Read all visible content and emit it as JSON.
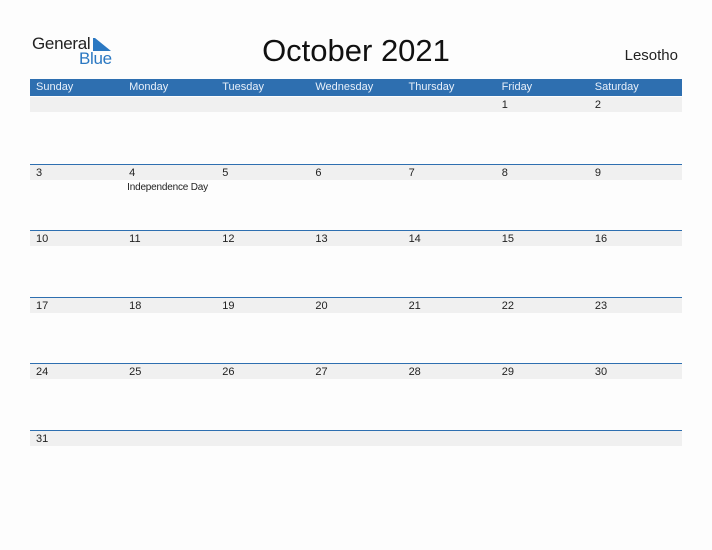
{
  "logo": {
    "general": "General",
    "blue": "Blue"
  },
  "title": "October 2021",
  "country": "Lesotho",
  "colors": {
    "accent": "#2e6fb0",
    "strip": "#f0f0f0",
    "logo_blue": "#2b78c2"
  },
  "weekdays": [
    "Sunday",
    "Monday",
    "Tuesday",
    "Wednesday",
    "Thursday",
    "Friday",
    "Saturday"
  ],
  "weeks": [
    [
      {
        "day": ""
      },
      {
        "day": ""
      },
      {
        "day": ""
      },
      {
        "day": ""
      },
      {
        "day": ""
      },
      {
        "day": "1"
      },
      {
        "day": "2"
      }
    ],
    [
      {
        "day": "3"
      },
      {
        "day": "4",
        "event": "Independence Day"
      },
      {
        "day": "5"
      },
      {
        "day": "6"
      },
      {
        "day": "7"
      },
      {
        "day": "8"
      },
      {
        "day": "9"
      }
    ],
    [
      {
        "day": "10"
      },
      {
        "day": "11"
      },
      {
        "day": "12"
      },
      {
        "day": "13"
      },
      {
        "day": "14"
      },
      {
        "day": "15"
      },
      {
        "day": "16"
      }
    ],
    [
      {
        "day": "17"
      },
      {
        "day": "18"
      },
      {
        "day": "19"
      },
      {
        "day": "20"
      },
      {
        "day": "21"
      },
      {
        "day": "22"
      },
      {
        "day": "23"
      }
    ],
    [
      {
        "day": "24"
      },
      {
        "day": "25"
      },
      {
        "day": "26"
      },
      {
        "day": "27"
      },
      {
        "day": "28"
      },
      {
        "day": "29"
      },
      {
        "day": "30"
      }
    ],
    [
      {
        "day": "31"
      },
      {
        "day": ""
      },
      {
        "day": ""
      },
      {
        "day": ""
      },
      {
        "day": ""
      },
      {
        "day": ""
      },
      {
        "day": ""
      }
    ]
  ]
}
